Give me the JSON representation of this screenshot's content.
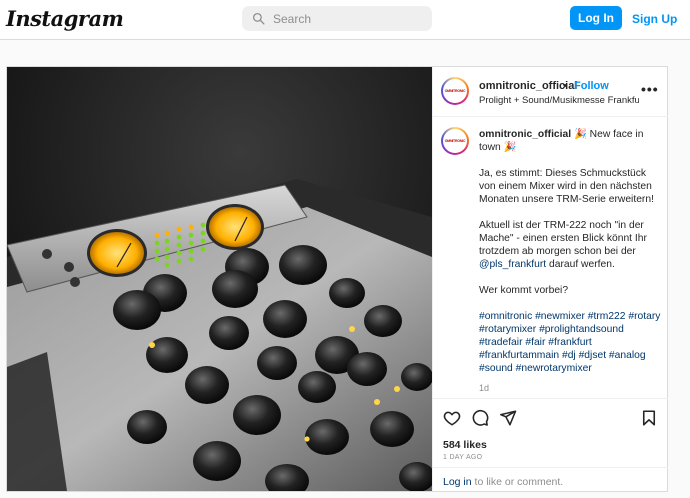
{
  "app": {
    "logo": "Instagram",
    "search_placeholder": "Search",
    "login_label": "Log In",
    "signup_label": "Sign Up"
  },
  "post": {
    "username": "omnitronic_official",
    "separator": "•",
    "follow_label": "Follow",
    "location": "Prolight + Sound/Musikmesse Frankfur...",
    "more_label": "•••",
    "avatar_text": "OMNITRONIC",
    "caption_title": " 🎉 New face in town 🎉",
    "caption_p1": "Ja, es stimmt: Dieses Schmuckstück von einem Mixer wird in den nächsten Monaten unsere TRM-Serie erweitern!",
    "caption_p2_a": "Aktuell ist der TRM-222 noch \"in der Mache\" - einen ersten Blick könnt Ihr trotzdem ab morgen schon bei der ",
    "caption_p2_mention": "@pls_frankfurt",
    "caption_p2_b": " darauf werfen.",
    "caption_p3": "Wer kommt vorbei?",
    "hashtags": "#omnitronic #newmixer #trm222 #rotary #rotarymixer #prolightandsound #tradefair #fair #frankfurt #frankfurtammain #dj #djset #analog #sound #newrotarymixer",
    "age": "1d",
    "likes": "584 likes",
    "date": "1 DAY AGO",
    "login_prompt_link": "Log in",
    "login_prompt_text": " to like or comment.",
    "photo_alt": "Black and white photo of a rotary DJ mixer with two glowing orange VU meters and green level LEDs"
  },
  "colors": {
    "accent": "#0095f6",
    "vu_meter": "#ffb000",
    "led_green": "#7ed321"
  },
  "icons": {
    "search": "search-icon",
    "like": "heart-icon",
    "comment": "comment-icon",
    "share": "share-icon",
    "save": "bookmark-icon"
  }
}
